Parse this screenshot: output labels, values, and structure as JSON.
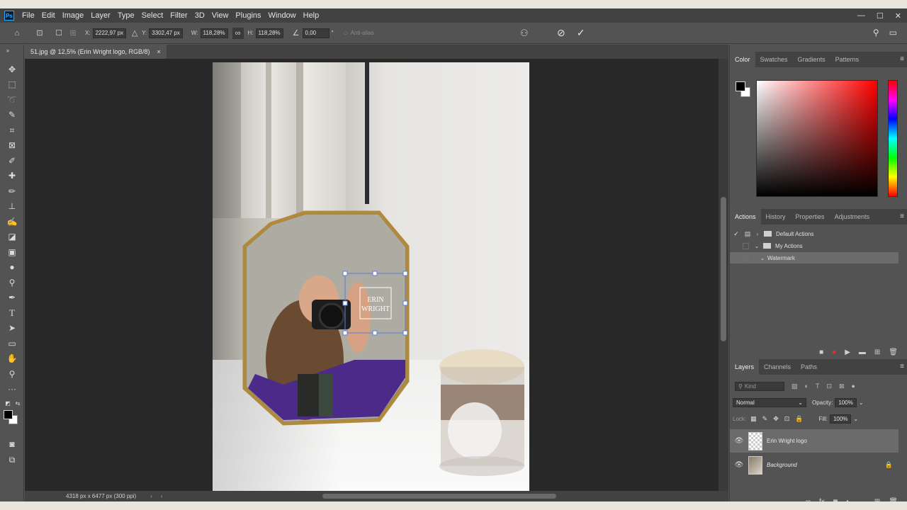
{
  "menu": {
    "logo": "Ps",
    "items": [
      "File",
      "Edit",
      "Image",
      "Layer",
      "Type",
      "Select",
      "Filter",
      "3D",
      "View",
      "Plugins",
      "Window",
      "Help"
    ]
  },
  "window_controls": {
    "minimize": "—",
    "maximize": "☐",
    "close": "✕"
  },
  "options_bar": {
    "x_label": "X:",
    "x_value": "2222,97 px",
    "y_label": "Y:",
    "y_value": "3302,47 px",
    "w_label": "W:",
    "w_value": "118,28%",
    "h_label": "H:",
    "h_value": "118,28%",
    "angle_value": "0,00",
    "angle_unit": "°",
    "anti_alias": "Anti-alias"
  },
  "document": {
    "tab_title": "51.jpg @ 12,5% (Erin Wright logo, RGB/8)",
    "close": "×",
    "status": "4318 px x 6477 px (300 ppi)",
    "watermark_line1": "ERIN",
    "watermark_line2": "WRIGHT"
  },
  "color_panel": {
    "tabs": [
      "Color",
      "Swatches",
      "Gradients",
      "Patterns"
    ],
    "foreground": "#000000",
    "background": "#ffffff",
    "hue": "#ff0000"
  },
  "actions_panel": {
    "tabs": [
      "Actions",
      "History",
      "Properties",
      "Adjustments"
    ],
    "rows": [
      {
        "label": "Default Actions"
      },
      {
        "label": "My Actions"
      },
      {
        "label": "Watermark"
      }
    ]
  },
  "layers_panel": {
    "tabs": [
      "Layers",
      "Channels",
      "Paths"
    ],
    "kind_placeholder": "Kind",
    "blend_mode": "Normal",
    "opacity_label": "Opacity:",
    "opacity_value": "100%",
    "lock_label": "Lock:",
    "fill_label": "Fill:",
    "fill_value": "100%",
    "layers": [
      {
        "name": "Erin Wright logo"
      },
      {
        "name": "Background"
      }
    ]
  },
  "colors": {
    "app_bg": "#535353",
    "panel_dark": "#424242",
    "canvas_bg": "#282828",
    "accent": "#31a8ff",
    "record_red": "#e03030"
  }
}
